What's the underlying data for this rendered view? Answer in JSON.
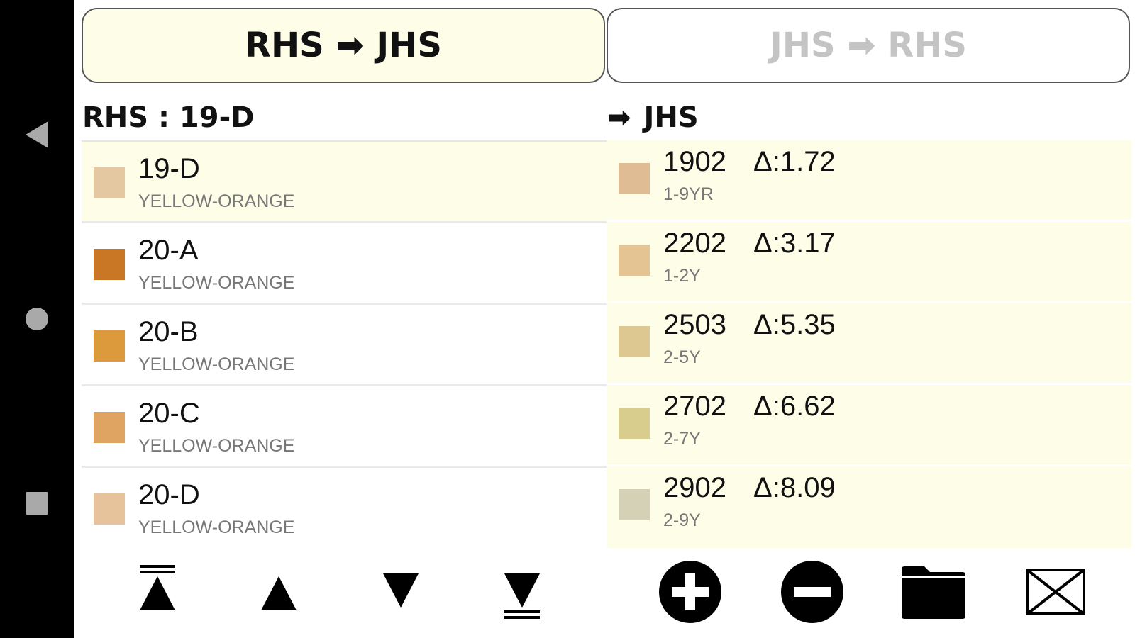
{
  "tabs": {
    "left_label": "RHS ➡ JHS",
    "right_label": "JHS ➡ RHS"
  },
  "left_header": "RHS : 19-D",
  "right_header": {
    "arrow": "➡",
    "label": "JHS"
  },
  "rhs_list": [
    {
      "code": "19-D",
      "group": "YELLOW-ORANGE",
      "color": "#e3c8a1",
      "selected": true
    },
    {
      "code": "20-A",
      "group": "YELLOW-ORANGE",
      "color": "#c97724"
    },
    {
      "code": "20-B",
      "group": "YELLOW-ORANGE",
      "color": "#dc9a3c"
    },
    {
      "code": "20-C",
      "group": "YELLOW-ORANGE",
      "color": "#e0a462"
    },
    {
      "code": "20-D",
      "group": "YELLOW-ORANGE",
      "color": "#e6c39b"
    }
  ],
  "jhs_list": [
    {
      "code": "1902",
      "delta": "Δ:1.72",
      "sub": "1-9YR",
      "color": "#e0bc94"
    },
    {
      "code": "2202",
      "delta": "Δ:3.17",
      "sub": "1-2Y",
      "color": "#e4c493"
    },
    {
      "code": "2503",
      "delta": "Δ:5.35",
      "sub": "2-5Y",
      "color": "#dcc890"
    },
    {
      "code": "2702",
      "delta": "Δ:6.62",
      "sub": "2-7Y",
      "color": "#d9cd8e"
    },
    {
      "code": "2902",
      "delta": "Δ:8.09",
      "sub": "2-9Y",
      "color": "#d5d1b6"
    }
  ],
  "toolbar_icons": [
    "scroll-top-icon",
    "scroll-up-icon",
    "scroll-down-icon",
    "scroll-bottom-icon",
    "add-icon",
    "remove-icon",
    "folder-icon",
    "mail-icon"
  ],
  "colors": {
    "highlight": "#fdfde8",
    "navbar": "#000000",
    "nav_icon": "#a9a9a9"
  }
}
